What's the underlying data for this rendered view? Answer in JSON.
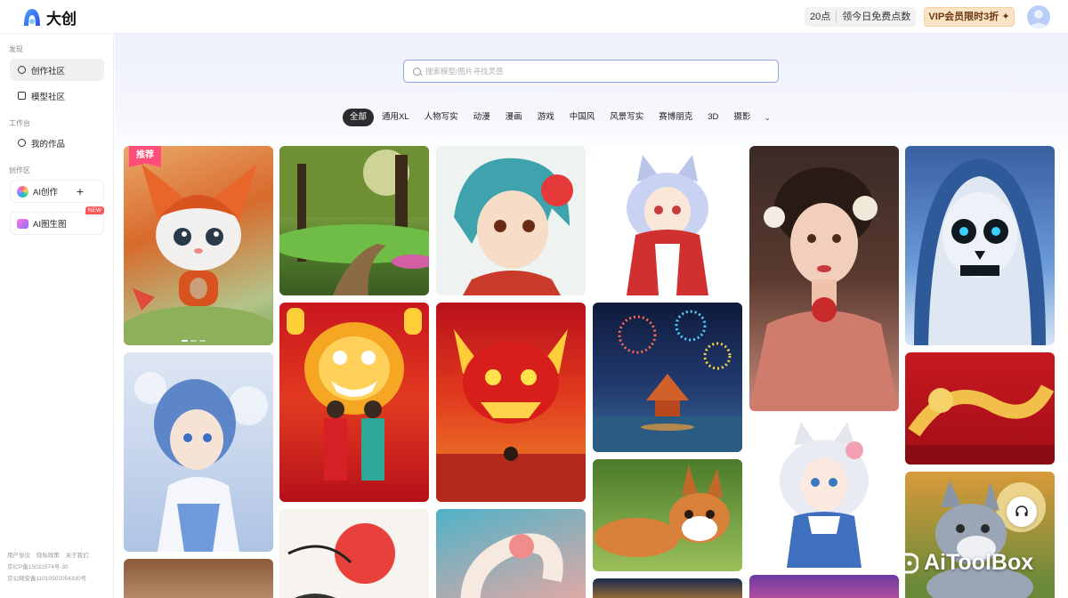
{
  "app": {
    "logo_text": "大创"
  },
  "header": {
    "points": "20点",
    "free_points": "领今日免费点数",
    "vip_label": "VIP会员限时3折"
  },
  "sidebar": {
    "discover_title": "发现",
    "discover_items": [
      {
        "label": "创作社区",
        "icon": "compass-icon"
      },
      {
        "label": "模型社区",
        "icon": "layers-icon"
      }
    ],
    "workspace_title": "工作台",
    "workspace_items": [
      {
        "label": "我的作品",
        "icon": "smile-icon"
      }
    ],
    "create_title": "创作区",
    "ai_create": "AI创作",
    "ai_image": "AI图生图",
    "new_badge": "NEW",
    "footer": {
      "links": [
        "用户协议",
        "隐私政策",
        "关于我们"
      ],
      "icp": "京ICP备15031574号-30",
      "police": "京公网安备11010502054330号"
    }
  },
  "search": {
    "placeholder": "搜索模型/图片寻找灵感"
  },
  "tabs": [
    "全部",
    "通用XL",
    "人物写实",
    "动漫",
    "漫画",
    "游戏",
    "中国风",
    "风景写实",
    "赛博朋克",
    "3D",
    "摄影"
  ],
  "recommend_badge": "推荐",
  "watermark": "AiToolBox",
  "colors": {
    "accent": "#8ea2e6",
    "tab_active": "#2c2c2e",
    "vip_bg": "#fbe3c5",
    "badge": "#ff4d7a"
  }
}
